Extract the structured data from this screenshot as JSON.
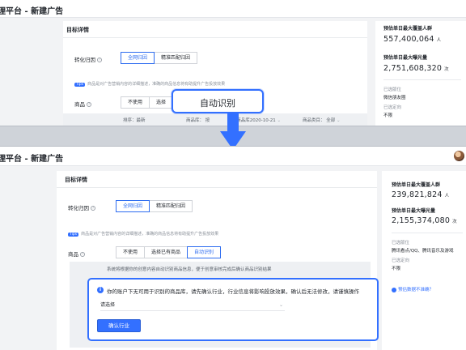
{
  "app": {
    "title": "理平台 - 新建广告"
  },
  "top": {
    "section_title": "目标详情",
    "conversion_label": "转化归因",
    "conversion_options": [
      "全网归因",
      "精准匹配归因"
    ],
    "tip_tag": "Tips",
    "tip_text": "商品是对广告营销内容的详细描述，准确的商品信息将有助提升广告投放效果",
    "product_label": "商品",
    "product_options": [
      "不使用",
      "选择"
    ],
    "filter_sort": "排序：最新",
    "filter_repo": "商品库：",
    "filter_repo_value": "按",
    "filter_repo_value2": "电商商品库2020-10-21",
    "filter_type": "商品类目：",
    "filter_type_value": "全部",
    "side": {
      "users_label": "预估单日最大覆盖人群",
      "users_value": "557,400,064",
      "users_unit": "人",
      "impr_label": "预估单日最大曝光量",
      "impr_value": "2,751,608,320",
      "impr_unit": "次",
      "placement_label": "已选版位",
      "placement_value": "微信朋友圈",
      "orientation_label": "已选定向",
      "orientation_value": "不限"
    },
    "callout": "自动识别"
  },
  "bottom": {
    "section_title": "目标详情",
    "conversion_label": "转化归因",
    "conversion_options": [
      "全网归因",
      "精准匹配归因"
    ],
    "tip_tag": "Tips",
    "tip_text": "商品是对广告营销内容的详细描述，准确的商品信息将有助提升广告投放效果",
    "product_label": "商品",
    "product_options": [
      "不使用",
      "选择已有商品",
      "自动识别"
    ],
    "system_text": "系统将根据你的创意内容自动识别商品信息，便于创意审核完成后确认商品识别结果",
    "dialog_msg": "你的账户下无可用于识别的商品库，请先确认行业，行业信息将影响投放效果，确认后无法修改，请谨慎操作",
    "select_placeholder": "请选择",
    "confirm_button": "确认行业",
    "side": {
      "users_label": "预估单日最大覆盖人群",
      "users_value": "239,821,824",
      "users_unit": "人",
      "impr_label": "预估单日最大曝光量",
      "impr_value": "2,155,374,080",
      "impr_unit": "次",
      "placement_label": "已选版位",
      "placement_value": "腾讯看点/QQ、腾讯音乐及游戏",
      "orientation_label": "已选定向",
      "orientation_value": "不限",
      "help_link": "预估数据不准确？"
    }
  },
  "colors": {
    "accent": "#3370ff",
    "background": "#f2f3f5"
  }
}
